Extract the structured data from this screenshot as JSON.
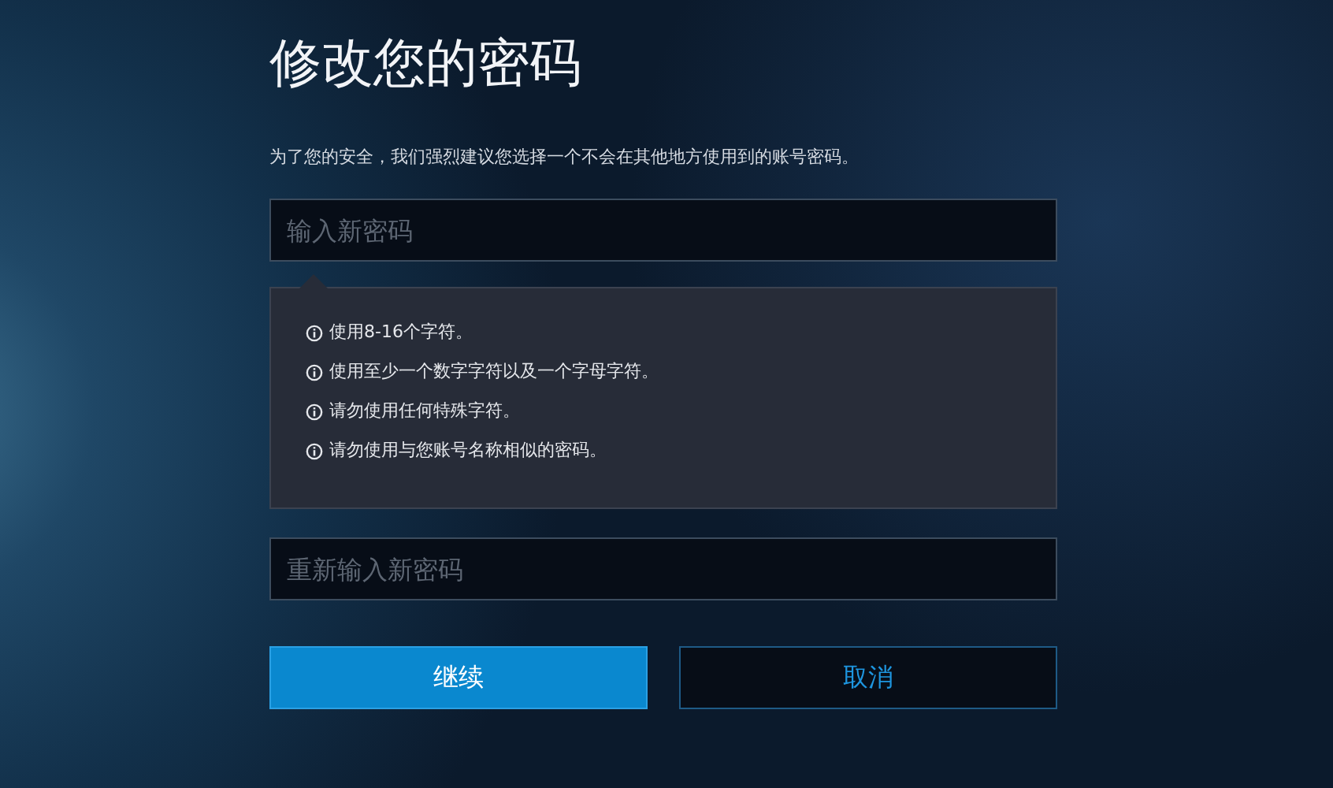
{
  "title": "修改您的密码",
  "description": "为了您的安全，我们强烈建议您选择一个不会在其他地方使用到的账号密码。",
  "new_password": {
    "placeholder": "输入新密码"
  },
  "requirements": [
    "使用8-16个字符。",
    "使用至少一个数字字符以及一个字母字符。",
    "请勿使用任何特殊字符。",
    "请勿使用与您账号名称相似的密码。"
  ],
  "confirm_password": {
    "placeholder": "重新输入新密码"
  },
  "buttons": [
    {
      "label": "继续",
      "kind": "primary"
    },
    {
      "label": "取消",
      "kind": "secondary"
    }
  ]
}
